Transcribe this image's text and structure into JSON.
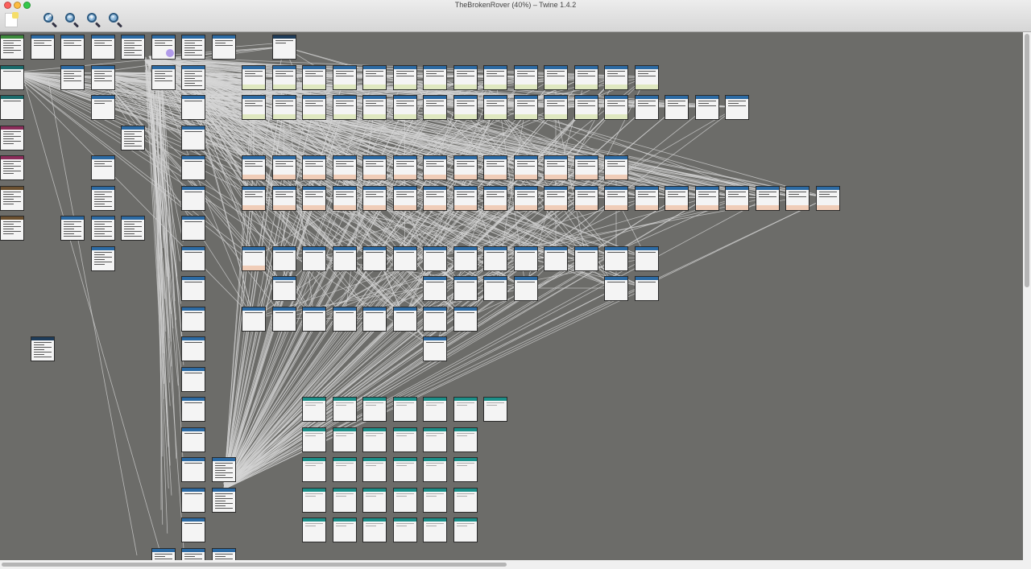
{
  "window": {
    "title": "TheBrokenRover (40%) – Twine 1.4.2"
  },
  "toolbar": {
    "new_passage_icon": "note-icon",
    "zoom_buttons": [
      {
        "icon": "zoom-fit-icon",
        "symbol": "⤢"
      },
      {
        "icon": "zoom-out-icon",
        "symbol": "−"
      },
      {
        "icon": "zoom-in-icon",
        "symbol": "+"
      },
      {
        "icon": "zoom-actual-icon",
        "symbol": "·"
      }
    ]
  },
  "colors": {
    "canvas": "#6c6c69",
    "header_blue": "#2c6aa3",
    "header_teal": "#1b8f88",
    "band_green": "#dfe8c0",
    "band_peach": "#f0cdb8",
    "link_line": "#d5d5d5",
    "selection": "#a58be6"
  }
}
